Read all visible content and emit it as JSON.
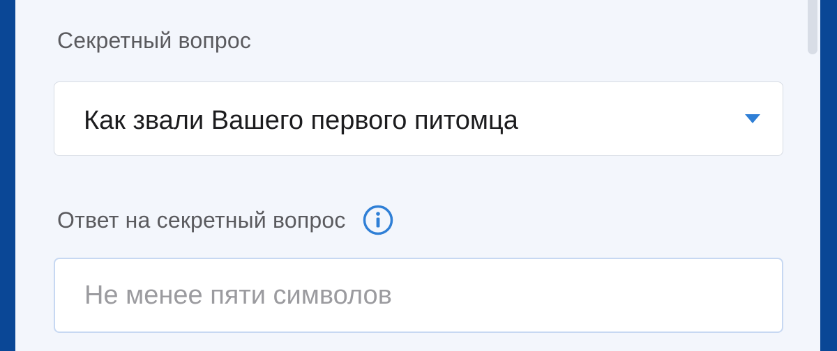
{
  "form": {
    "secret_question": {
      "label": "Секретный вопрос",
      "selected_value": "Как звали Вашего первого питомца",
      "dropdown_icon": "chevron-down-icon"
    },
    "secret_answer": {
      "label": "Ответ на секретный вопрос",
      "info_icon": "info-icon",
      "placeholder": "Не менее пяти символов",
      "value": ""
    }
  },
  "colors": {
    "frame_background": "#0a4796",
    "panel_background": "#f3f6fc",
    "accent": "#2f7fd6",
    "label_text": "#5a5a5e",
    "placeholder_text": "#9b9b9f"
  }
}
